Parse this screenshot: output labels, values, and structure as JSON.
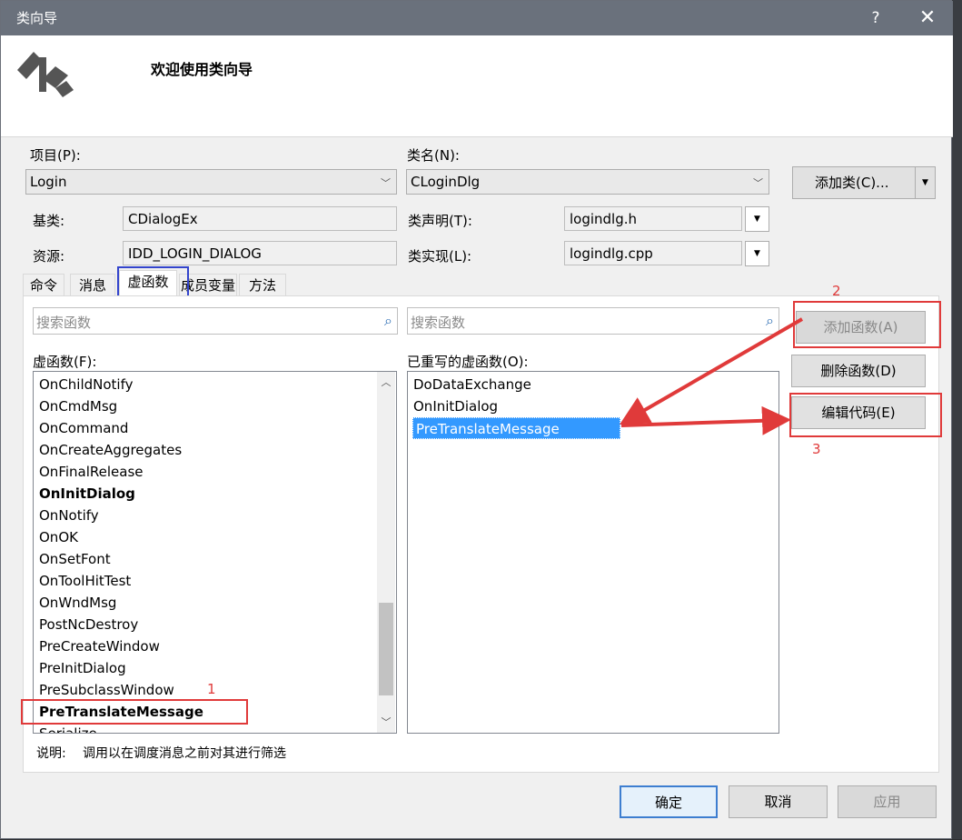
{
  "window": {
    "title": "类向导",
    "help": "?",
    "close": "✕",
    "welcome": "欢迎使用类向导"
  },
  "project": {
    "label": "项目(P):",
    "value": "Login"
  },
  "classname": {
    "label": "类名(N):",
    "value": "CLoginDlg"
  },
  "add_class_button": "添加类(C)...",
  "base_class": {
    "label": "基类:",
    "value": "CDialogEx"
  },
  "resource": {
    "label": "资源:",
    "value": "IDD_LOGIN_DIALOG"
  },
  "class_decl": {
    "label": "类声明(T):",
    "value": "logindlg.h"
  },
  "class_impl": {
    "label": "类实现(L):",
    "value": "logindlg.cpp"
  },
  "tabs": [
    {
      "label": "命令"
    },
    {
      "label": "消息"
    },
    {
      "label": "虚函数"
    },
    {
      "label": "成员变量"
    },
    {
      "label": "方法"
    }
  ],
  "search_left_placeholder": "搜索函数",
  "search_right_placeholder": "搜索函数",
  "virtual_list": {
    "label": "虚函数(F):",
    "items": [
      "OnChildNotify",
      "OnCmdMsg",
      "OnCommand",
      "OnCreateAggregates",
      "OnFinalRelease",
      "OnInitDialog",
      "OnNotify",
      "OnOK",
      "OnSetFont",
      "OnToolHitTest",
      "OnWndMsg",
      "PostNcDestroy",
      "PreCreateWindow",
      "PreInitDialog",
      "PreSubclassWindow",
      "PreTranslateMessage",
      "Serialize"
    ]
  },
  "overridden_list": {
    "label": "已重写的虚函数(O):",
    "items": [
      "DoDataExchange",
      "OnInitDialog",
      "PreTranslateMessage"
    ]
  },
  "buttons": {
    "add_function": "添加函数(A)",
    "delete_function": "删除函数(D)",
    "edit_code": "编辑代码(E)"
  },
  "description": {
    "label": "说明:",
    "text": "调用以在调度消息之前对其进行筛选"
  },
  "footer": {
    "ok": "确定",
    "cancel": "取消",
    "apply": "应用"
  },
  "annotations": {
    "n1": "1",
    "n2": "2",
    "n3": "3"
  },
  "colors": {
    "annotation_red": "#e03a3a",
    "highlight_blue": "#3344cc",
    "selection": "#3399ff"
  }
}
